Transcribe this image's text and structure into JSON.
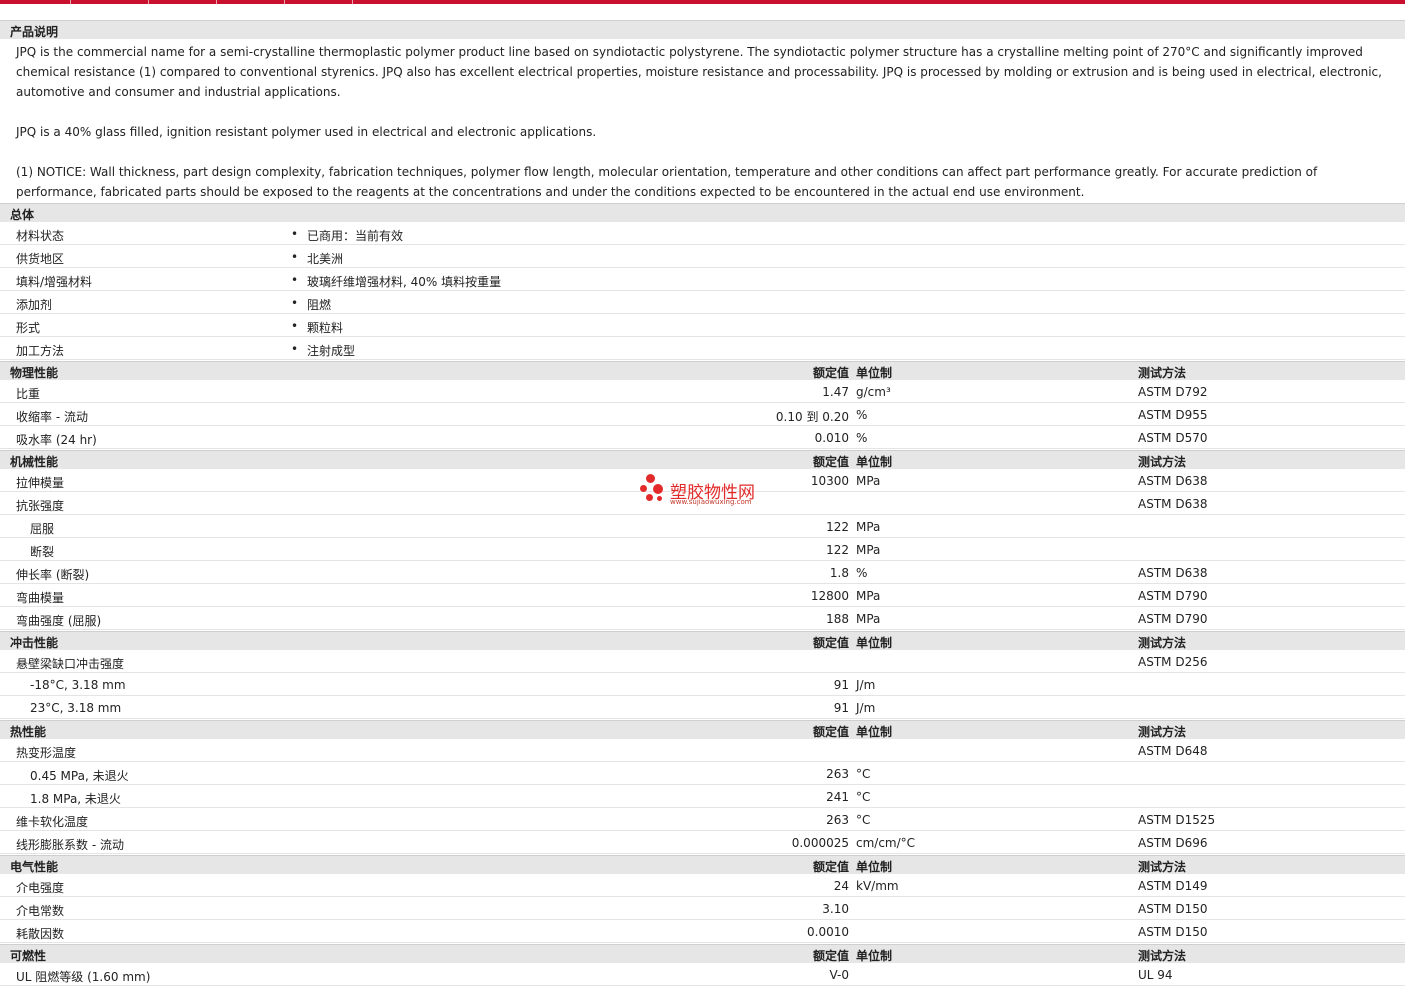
{
  "sections": {
    "desc_title": "产品说明",
    "general_title": "总体",
    "physical_title": "物理性能",
    "mechanical_title": "机械性能",
    "impact_title": "冲击性能",
    "thermal_title": "热性能",
    "electrical_title": "电气性能",
    "flammability_title": "可燃性"
  },
  "headers": {
    "value": "额定值",
    "unit": "单位制",
    "method": "测试方法"
  },
  "description": {
    "p1": "JPQ is the commercial name for a semi-crystalline thermoplastic polymer product line based on syndiotactic polystyrene. The syndiotactic polymer structure has a crystalline melting point of 270°C and significantly improved chemical resistance (1) compared to conventional styrenics. JPQ also has excellent electrical properties, moisture resistance and processability. JPQ is processed by molding or extrusion and is being used in electrical, electronic, automotive and consumer and industrial applications.",
    "p2": "JPQ is a 40% glass filled, ignition resistant polymer used in electrical and electronic applications.",
    "p3": "(1) NOTICE: Wall thickness, part design complexity, fabrication techniques, polymer flow length, molecular orientation, temperature and other conditions can affect part performance greatly. For accurate prediction of performance, fabricated parts should be exposed to the reagents at the concentrations and under the conditions expected to be encountered in the actual end use environment."
  },
  "general": [
    {
      "name": "材料状态",
      "value": "已商用：当前有效"
    },
    {
      "name": "供货地区",
      "value": "北美洲"
    },
    {
      "name": "填料/增强材料",
      "value": "玻璃纤维增强材料, 40% 填料按重量"
    },
    {
      "name": "添加剂",
      "value": "阻燃"
    },
    {
      "name": "形式",
      "value": "颗粒料"
    },
    {
      "name": "加工方法",
      "value": "注射成型"
    }
  ],
  "physical": [
    {
      "name": "比重",
      "value": "1.47",
      "unit": "g/cm³",
      "method": "ASTM D792"
    },
    {
      "name": "收缩率  - 流动",
      "value": "0.10 到  0.20",
      "unit": "%",
      "method": "ASTM D955"
    },
    {
      "name": "吸水率  (24 hr)",
      "value": "0.010",
      "unit": "%",
      "method": "ASTM D570"
    }
  ],
  "mechanical": [
    {
      "name": "拉伸模量",
      "value": "10300",
      "unit": "MPa",
      "method": "ASTM D638"
    },
    {
      "name": "抗张强度",
      "value": "",
      "unit": "",
      "method": "ASTM D638"
    },
    {
      "name": "屈服",
      "value": "122",
      "unit": "MPa",
      "method": "",
      "sub": true
    },
    {
      "name": "断裂",
      "value": "122",
      "unit": "MPa",
      "method": "",
      "sub": true
    },
    {
      "name": "伸长率  (断裂)",
      "value": "1.8",
      "unit": "%",
      "method": "ASTM D638"
    },
    {
      "name": "弯曲模量",
      "value": "12800",
      "unit": "MPa",
      "method": "ASTM D790"
    },
    {
      "name": "弯曲强度  (屈服)",
      "value": "188",
      "unit": "MPa",
      "method": "ASTM D790"
    }
  ],
  "impact": [
    {
      "name": "悬壁梁缺口冲击强度",
      "value": "",
      "unit": "",
      "method": "ASTM D256"
    },
    {
      "name": "-18°C, 3.18 mm",
      "value": "91",
      "unit": "J/m",
      "method": "",
      "sub": true
    },
    {
      "name": "23°C, 3.18 mm",
      "value": "91",
      "unit": "J/m",
      "method": "",
      "sub": true
    }
  ],
  "thermal": [
    {
      "name": "热变形温度",
      "value": "",
      "unit": "",
      "method": "ASTM D648"
    },
    {
      "name": "0.45 MPa, 未退火",
      "value": "263",
      "unit": "°C",
      "method": "",
      "sub": true
    },
    {
      "name": "1.8 MPa, 未退火",
      "value": "241",
      "unit": "°C",
      "method": "",
      "sub": true
    },
    {
      "name": "维卡软化温度",
      "value": "263",
      "unit": "°C",
      "method": "ASTM D1525"
    },
    {
      "name": "线形膨胀系数  - 流动",
      "value": "0.000025",
      "unit": "cm/cm/°C",
      "method": "ASTM D696"
    }
  ],
  "electrical": [
    {
      "name": "介电强度",
      "value": "24",
      "unit": "kV/mm",
      "method": "ASTM D149"
    },
    {
      "name": "介电常数",
      "value": "3.10",
      "unit": "",
      "method": "ASTM D150"
    },
    {
      "name": "耗散因数",
      "value": "0.0010",
      "unit": "",
      "method": "ASTM D150"
    }
  ],
  "flammability": [
    {
      "name": "UL 阻燃等级  (1.60 mm)",
      "value": "V-0",
      "unit": "",
      "method": "UL 94"
    }
  ],
  "watermark": {
    "cn": "塑胶物性网",
    "url": "www.sujiaowuxing.com"
  },
  "colors": {
    "accent": "#c8102e",
    "section_bg": "#e6e6e6",
    "watermark": "#e32a2a"
  }
}
